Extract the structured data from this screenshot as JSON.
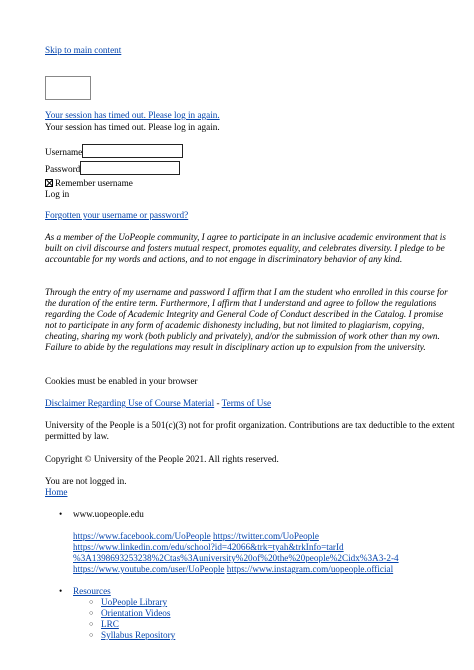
{
  "skip_link": "Skip to main content",
  "timeout_link": "Your session has timed out. Please log in again.",
  "timeout_text": "Your session has timed out. Please log in again.",
  "form": {
    "username_label": "Username",
    "username_value": "",
    "password_label": "Password",
    "password_value": "",
    "remember_label": "Remember username",
    "remember_checked": true,
    "login_label": "Log in",
    "forgot_link": "Forgotten your username or password?"
  },
  "pledge_1": "As a member of the UoPeople community, I agree to participate in an inclusive academic environment that is built on civil discourse and fosters mutual respect, promotes equality, and celebrates diversity. I pledge to be accountable for my words and actions, and to not engage in discriminatory behavior of any kind.",
  "pledge_2": "Through the entry of my username and password I affirm that I am the student who enrolled in this course for the duration of the entire term. Furthermore, I affirm that I understand and agree to follow the regulations regarding the Code of Academic Integrity and General Code of Conduct described in the Catalog. I promise not to participate in any form of academic dishonesty including, but not limited to plagiarism, copying, cheating, sharing my work (both publicly and privately), and/or the submission of work other than my own. Failure to abide by the regulations may result in disciplinary action up to expulsion from the university.",
  "cookies_text": "Cookies must be enabled in your browser",
  "footer": {
    "disclaimer_link": "Disclaimer Regarding Use of Course Material",
    "separator": " - ",
    "terms_link": "Terms of Use",
    "nonprofit_text": "University of the People is a 501(c)(3) not for profit organization. Contributions are tax deductible to the extent permitted by law.",
    "copyright": "Copyright © University of the People 2021. All rights reserved.",
    "not_logged_in": "You are not logged in.",
    "home_link": "Home"
  },
  "site_url": "www.uopeople.edu",
  "social_links": [
    "https://www.facebook.com/UoPeople",
    "https://twitter.com/UoPeople",
    "https://www.linkedin.com/edu/school?id=42066&trk=tyah&trkInfo=tarId",
    "%3A1398693253238%2Ctas%3Auniversity%20of%20the%20people%2Cidx%3A3-2-4",
    "https://www.youtube.com/user/UoPeople",
    "https://www.instagram.com/uopeople.official"
  ],
  "resources": {
    "label": "Resources",
    "items": [
      "UoPeople Library",
      "Orientation Videos",
      "LRC",
      "Syllabus Repository"
    ]
  }
}
